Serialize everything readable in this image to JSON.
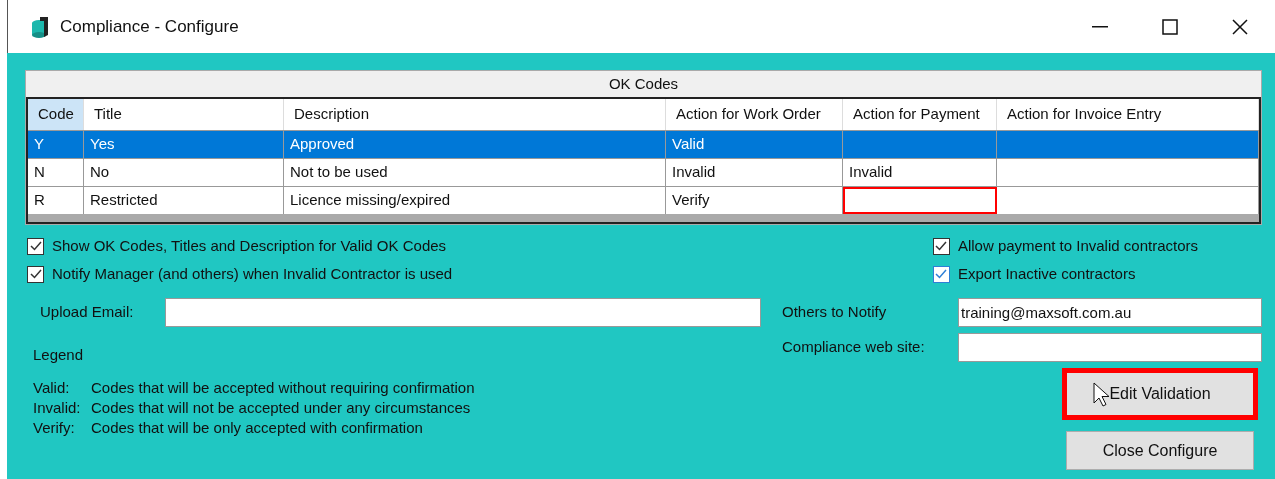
{
  "window": {
    "title": "Compliance - Configure"
  },
  "grid": {
    "title": "OK Codes",
    "columns": [
      "Code",
      "Title",
      "Description",
      "Action for Work Order",
      "Action for Payment",
      "Action for Invoice Entry"
    ],
    "rows": [
      {
        "selected": true,
        "cells": [
          {
            "text": "Y",
            "highlighted": false
          },
          {
            "text": "Yes",
            "highlighted": false
          },
          {
            "text": "Approved",
            "highlighted": false
          },
          {
            "text": "Valid",
            "highlighted": false
          },
          {
            "highlighted": false
          },
          {
            "highlighted": false
          }
        ]
      },
      {
        "selected": false,
        "cells": [
          {
            "text": "N",
            "highlighted": false
          },
          {
            "text": "No",
            "highlighted": false
          },
          {
            "text": "Not to be used",
            "highlighted": false
          },
          {
            "text": "Invalid",
            "highlighted": false
          },
          {
            "text": "Invalid",
            "highlighted": false
          },
          {
            "highlighted": false
          }
        ]
      },
      {
        "selected": false,
        "cells": [
          {
            "text": "R",
            "highlighted": false
          },
          {
            "text": "Restricted",
            "highlighted": false
          },
          {
            "text": "Licence missing/expired",
            "highlighted": false
          },
          {
            "text": "Verify",
            "highlighted": false
          },
          {
            "highlighted": true
          },
          {
            "highlighted": false
          }
        ]
      }
    ]
  },
  "checkboxes_left": [
    {
      "label": "Show OK Codes, Titles and Description for Valid OK Codes",
      "checked": true,
      "focused": false
    },
    {
      "label": "Notify Manager (and others) when Invalid Contractor is used",
      "checked": true,
      "focused": false
    }
  ],
  "checkboxes_right": [
    {
      "label": "Allow payment to Invalid contractors",
      "checked": true,
      "focused": false
    },
    {
      "label": "Export Inactive contractors",
      "checked": true,
      "focused": true
    }
  ],
  "upload_email": {
    "label": "Upload Email:"
  },
  "others_to_notify": {
    "label": "Others to Notify",
    "value": "training@maxsoft.com.au"
  },
  "compliance_web_site": {
    "label": "Compliance web site:"
  },
  "legend": {
    "title": "Legend",
    "items": [
      {
        "term": "Valid:",
        "text": "Codes that will be accepted without requiring confirmation"
      },
      {
        "term": "Invalid:",
        "text": "Codes that will not be accepted under any circumstances"
      },
      {
        "term": "Verify:",
        "text": "Codes that will be only accepted with confirmation"
      }
    ]
  },
  "buttons": [
    {
      "label": "Edit Validation",
      "highlighted": true
    },
    {
      "label": "Close Configure",
      "highlighted": false
    }
  ]
}
